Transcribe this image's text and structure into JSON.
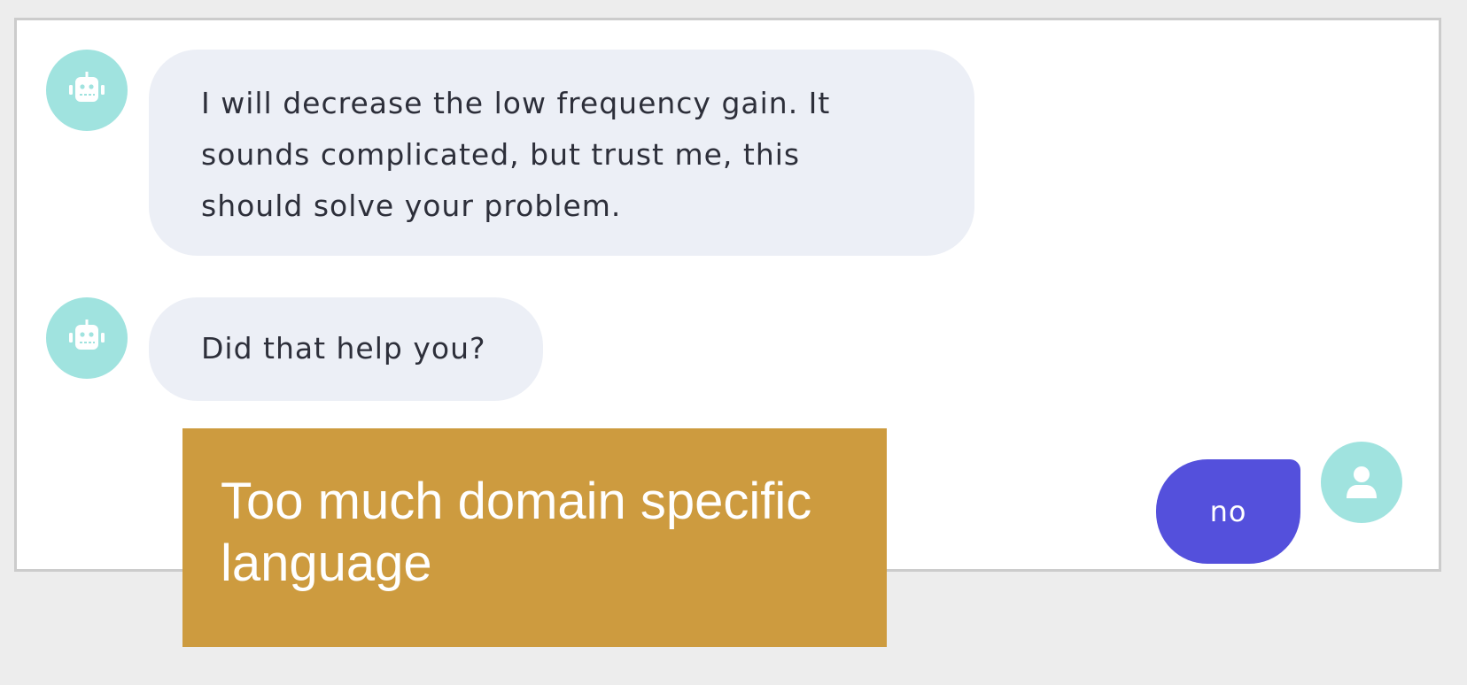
{
  "colors": {
    "page_background": "#ededed",
    "window_background": "#ffffff",
    "avatar": "#a0e3df",
    "bot_bubble": "#eceff6",
    "user_bubble": "#5450dc",
    "annotation": "#cd9b3f"
  },
  "messages": [
    {
      "sender": "bot",
      "avatar_icon": "robot-icon",
      "lines": [
        "I will decrease the low frequency gain. It",
        "sounds complicated, but trust me, this",
        "should solve your problem."
      ]
    },
    {
      "sender": "bot",
      "avatar_icon": "robot-icon",
      "lines": [
        "Did that help you?"
      ]
    },
    {
      "sender": "user",
      "avatar_icon": "user-icon",
      "text": "no"
    }
  ],
  "annotation": {
    "lines": [
      "Too much domain specific",
      "language"
    ]
  }
}
